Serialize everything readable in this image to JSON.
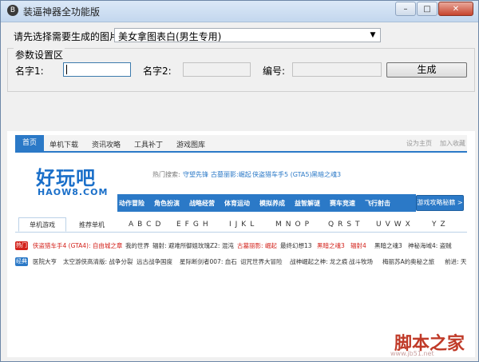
{
  "window": {
    "title": "装逼神器全功能版",
    "icon_letter": "B",
    "controls": [
      "minimize-icon",
      "maximize-icon",
      "close-icon"
    ]
  },
  "form": {
    "select_label": "请先选择需要生成的图片:",
    "select_value": "美女拿图表白(男生专用)",
    "group_title": "参数设置区",
    "name1_label": "名字1:",
    "name1_value": "",
    "name2_label": "名字2:",
    "name2_value": "",
    "number_label": "编号:",
    "number_value": "",
    "generate_label": "生成"
  },
  "preview": {
    "nav": [
      "首页",
      "单机下载",
      "资讯攻略",
      "工具补丁",
      "游戏图库"
    ],
    "nav_right": [
      "设为主页",
      "加入收藏"
    ],
    "logo": "好玩吧",
    "logo_sub": "HAOW8.COM",
    "hot_label": "热门搜索:",
    "hot_links": [
      "守望先锋",
      "古墓丽影:崛起",
      "侠盗猎车手5 (GTA5)",
      "黑暗之魂3"
    ],
    "categories": [
      "动作冒险",
      "角色扮演",
      "战略经营",
      "体育运动",
      "模拟养成",
      "益智解谜",
      "赛车竞速",
      "飞行射击"
    ],
    "guide_button": "游戏攻略秘籍 >",
    "tabs": [
      "单机游戏",
      "推荐单机"
    ],
    "letters": [
      "ABCD",
      "EFGH",
      "IJKL",
      "MNOP",
      "QRST",
      "UVWX",
      "YZ"
    ],
    "row1_badge": "热门",
    "row1": [
      "侠盗猎车手4 (GTA4): 自由城之章",
      "我的世界",
      "辐射: 避难所",
      "御姐玫瑰Z2: 混沌",
      "古墓丽影: 崛起",
      "最终幻想13",
      "黑暗之魂3",
      "辐射4",
      "黑暗之魂3",
      "神秘海域4: 盗贼"
    ],
    "row2_badge": "经典",
    "row2": [
      "医院大亨",
      "太空游侠高清版: 战争分裂",
      "远古战争国度",
      "星际断剑者007: 血石",
      "诅咒世界大冒险",
      "战神崛起之神: 龙之痕",
      "战斗牧场",
      "梅丽苏A的奥秘之旅",
      "前进: 天"
    ]
  },
  "watermark": {
    "main": "脚本之家",
    "url": "www.jb51.net"
  }
}
